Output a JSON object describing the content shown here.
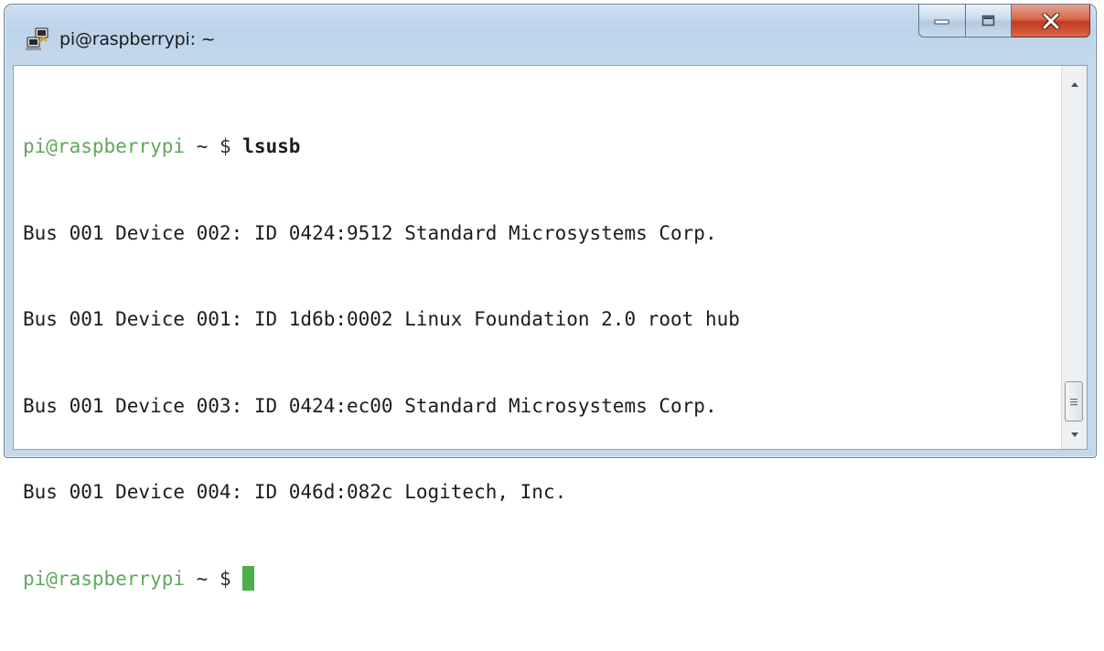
{
  "window": {
    "title": "pi@raspberrypi: ~",
    "icon": "putty-icon",
    "caption_buttons": [
      "minimize-icon",
      "maximize-icon",
      "close-icon"
    ]
  },
  "colors": {
    "prompt_user": "#5fa85a",
    "cursor": "#4caf4a",
    "text": "#1c1c1c",
    "close_button": "#c2391e"
  },
  "terminal": {
    "prompt_user": "pi@raspberrypi",
    "prompt_path": " ~ $ ",
    "command": "lsusb",
    "output": [
      "Bus 001 Device 002: ID 0424:9512 Standard Microsystems Corp.",
      "Bus 001 Device 001: ID 1d6b:0002 Linux Foundation 2.0 root hub",
      "Bus 001 Device 003: ID 0424:ec00 Standard Microsystems Corp.",
      "Bus 001 Device 004: ID 046d:082c Logitech, Inc."
    ],
    "second_prompt_user": "pi@raspberrypi",
    "second_prompt_path": " ~ $ "
  }
}
